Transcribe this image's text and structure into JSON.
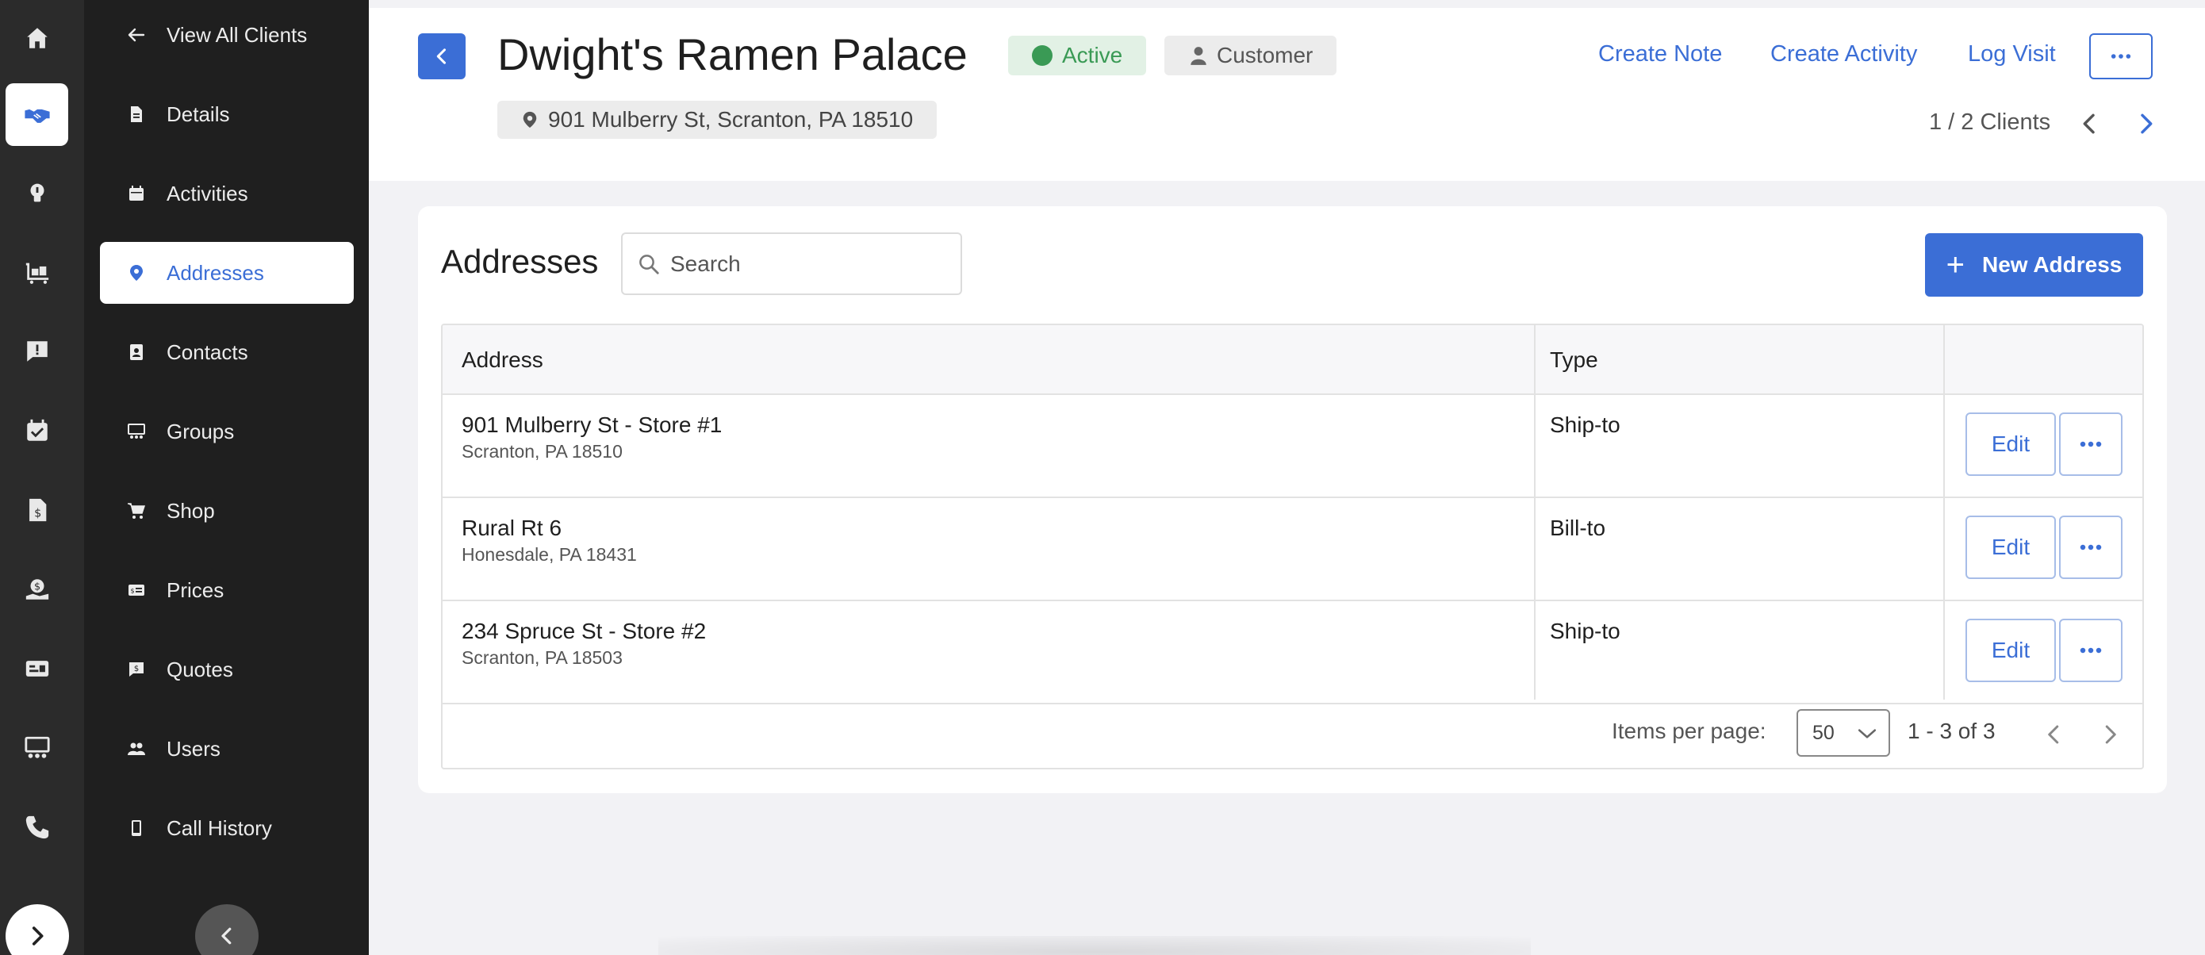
{
  "menu": {
    "back_label": "View All Clients",
    "items": [
      {
        "label": "Details",
        "icon": "document-icon"
      },
      {
        "label": "Activities",
        "icon": "calendar-icon"
      },
      {
        "label": "Addresses",
        "icon": "location-pin-icon",
        "active": true
      },
      {
        "label": "Contacts",
        "icon": "contact-card-icon"
      },
      {
        "label": "Groups",
        "icon": "groups-icon"
      },
      {
        "label": "Shop",
        "icon": "cart-icon"
      },
      {
        "label": "Prices",
        "icon": "price-tag-icon"
      },
      {
        "label": "Quotes",
        "icon": "quote-icon"
      },
      {
        "label": "Users",
        "icon": "users-icon"
      },
      {
        "label": "Call History",
        "icon": "phone-device-icon"
      }
    ]
  },
  "rail": {
    "items": [
      "home-icon",
      "handshake-icon",
      "lightbulb-icon",
      "warehouse-cart-icon",
      "chat-alert-icon",
      "calendar-check-icon",
      "invoice-icon",
      "money-hand-icon",
      "id-card-icon",
      "presentation-icon",
      "phone-icon"
    ]
  },
  "header": {
    "title": "Dwight's Ramen Palace",
    "status": "Active",
    "role": "Customer",
    "address": "901 Mulberry St, Scranton, PA 18510",
    "links": [
      "Create Note",
      "Create Activity",
      "Log Visit"
    ],
    "pager": "1 / 2 Clients"
  },
  "addresses": {
    "title": "Addresses",
    "search_placeholder": "Search",
    "new_button": "New Address",
    "columns": [
      "Address",
      "Type"
    ],
    "rows": [
      {
        "line1": "901 Mulberry St - Store #1",
        "line2": "Scranton, PA 18510",
        "type": "Ship-to"
      },
      {
        "line1": "Rural Rt 6",
        "line2": "Honesdale, PA 18431",
        "type": "Bill-to"
      },
      {
        "line1": "234 Spruce St - Store #2",
        "line2": "Scranton, PA 18503",
        "type": "Ship-to"
      }
    ],
    "edit_label": "Edit",
    "items_per_page_label": "Items per page:",
    "items_per_page": "50",
    "range": "1 - 3 of 3"
  },
  "colors": {
    "accent": "#3b6ed6",
    "rail_bg": "#2b2b2b",
    "menu_bg": "#1f1f1f",
    "active_green": "#3a9a55"
  }
}
